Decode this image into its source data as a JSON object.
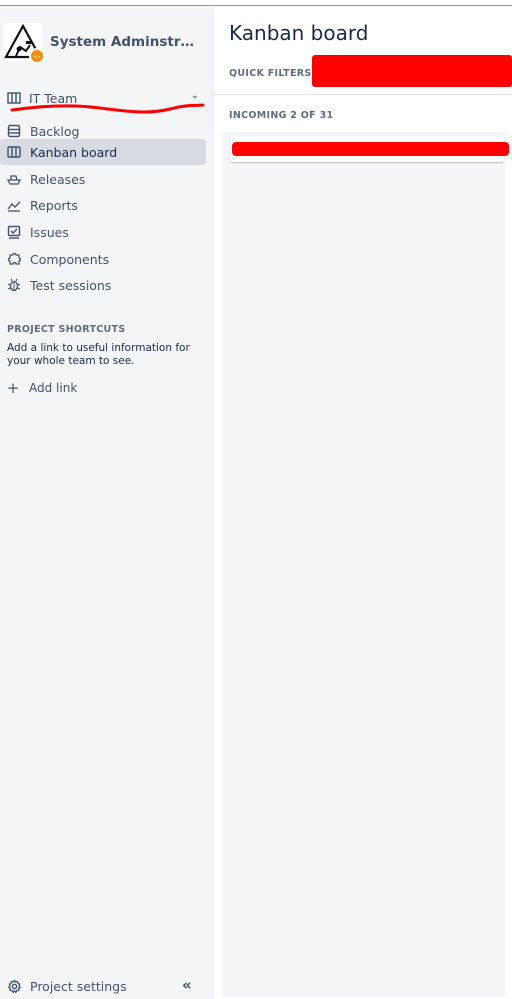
{
  "project": {
    "name": "System Adminstrat…"
  },
  "board_switcher": {
    "label": "IT Team"
  },
  "nav": [
    {
      "label": "Backlog",
      "icon": "backlog-icon"
    },
    {
      "label": "Kanban board",
      "icon": "board-icon",
      "active": true
    },
    {
      "label": "Releases",
      "icon": "ship-icon"
    },
    {
      "label": "Reports",
      "icon": "chart-icon"
    },
    {
      "label": "Issues",
      "icon": "issues-icon"
    },
    {
      "label": "Components",
      "icon": "puzzle-icon"
    },
    {
      "label": "Test sessions",
      "icon": "bug-icon"
    }
  ],
  "shortcuts": {
    "title": "PROJECT SHORTCUTS",
    "description": "Add a link to useful information for your whole team to see.",
    "add_link": "Add link"
  },
  "footer": {
    "settings": "Project settings"
  },
  "main": {
    "title": "Kanban board",
    "quick_filters_label": "QUICK FILTERS:",
    "column_header": "INCOMING 2 OF 31"
  },
  "colors": {
    "accent_orange": "#FF8B00",
    "redaction": "#FF0000",
    "sidebar_bg": "#F4F5F7",
    "active_bg": "#D8DBE1"
  }
}
